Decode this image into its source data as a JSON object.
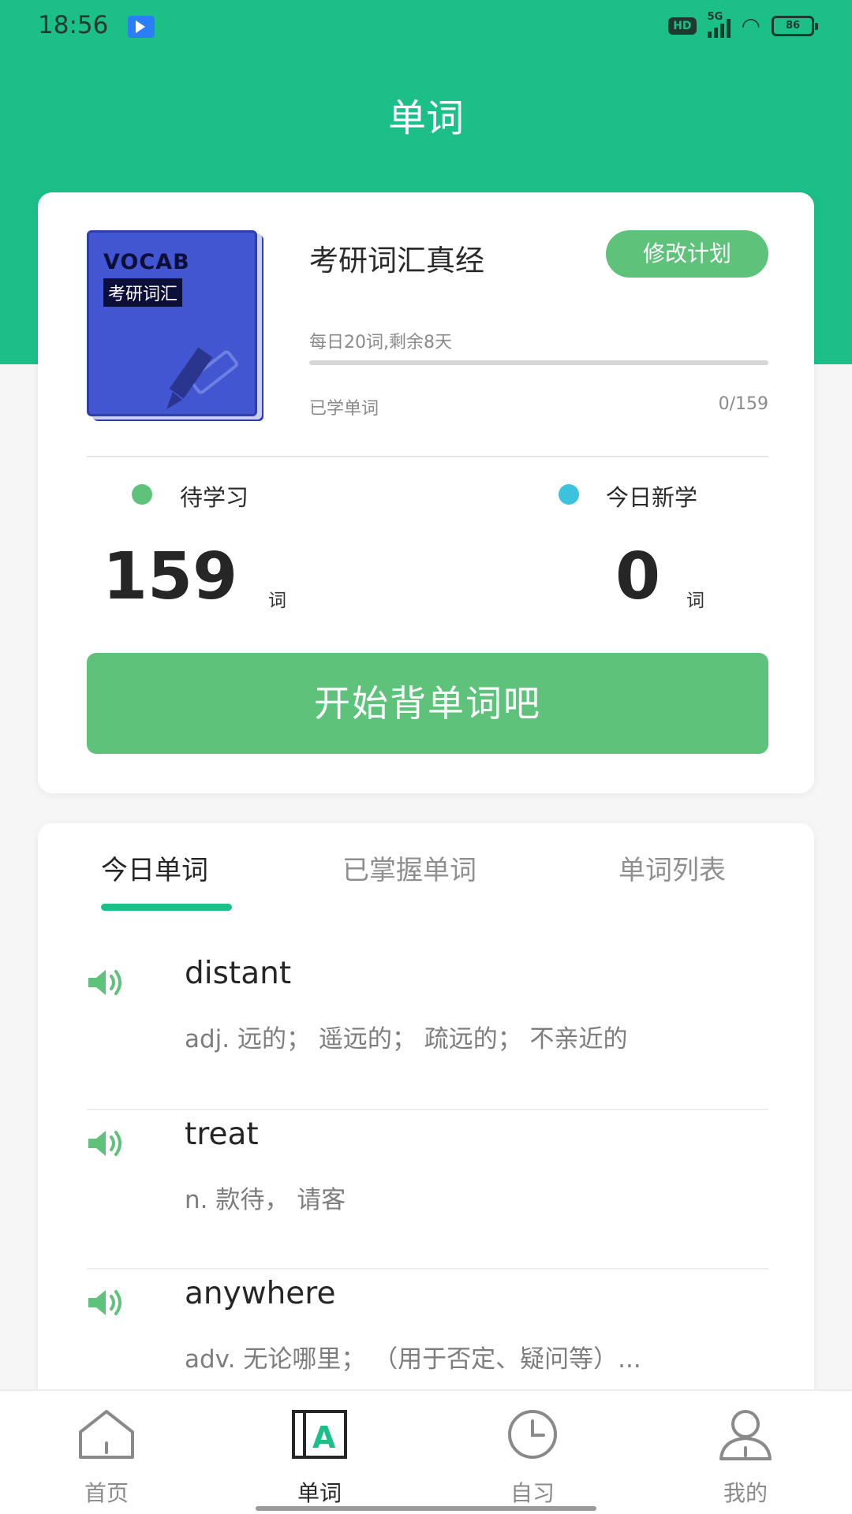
{
  "status_bar": {
    "time": "18:56",
    "hd_label": "HD",
    "network": "5G",
    "battery_level": "86"
  },
  "header": {
    "title": "单词"
  },
  "plan_card": {
    "cover_title": "VOCAB",
    "cover_subtitle": "考研词汇",
    "book_title": "考研词汇真经",
    "edit_plan_label": "修改计划",
    "daily_plan": "每日20词,剩余8天",
    "learned_label": "已学单词",
    "learned_count": "0/159",
    "progress_fraction": 0,
    "pending": {
      "label": "待学习",
      "value": "159",
      "unit": "词"
    },
    "today_new": {
      "label": "今日新学",
      "value": "0",
      "unit": "词"
    },
    "start_button_label": "开始背单词吧"
  },
  "colors": {
    "brand_green": "#1cbf88",
    "button_green": "#5fc27a",
    "accent_cyan": "#3cc2de",
    "cover_blue": "#4356d2"
  },
  "tabs": [
    {
      "label": "今日单词",
      "active": true
    },
    {
      "label": "已掌握单词",
      "active": false
    },
    {
      "label": "单词列表",
      "active": false
    }
  ],
  "words": [
    {
      "word": "distant",
      "definition": "adj. 远的；  遥远的；  疏远的；  不亲近的",
      "icon": "speaker-icon"
    },
    {
      "word": "treat",
      "definition": "n. 款待，  请客",
      "icon": "speaker-icon"
    },
    {
      "word": "anywhere",
      "definition": "adv. 无论哪里；  （用于否定、疑问等）...",
      "icon": "speaker-icon"
    }
  ],
  "nav": [
    {
      "label": "首页",
      "icon": "home-icon"
    },
    {
      "label": "单词",
      "icon": "vocabulary-book-icon"
    },
    {
      "label": "自习",
      "icon": "clock-icon"
    },
    {
      "label": "我的",
      "icon": "user-icon"
    }
  ]
}
